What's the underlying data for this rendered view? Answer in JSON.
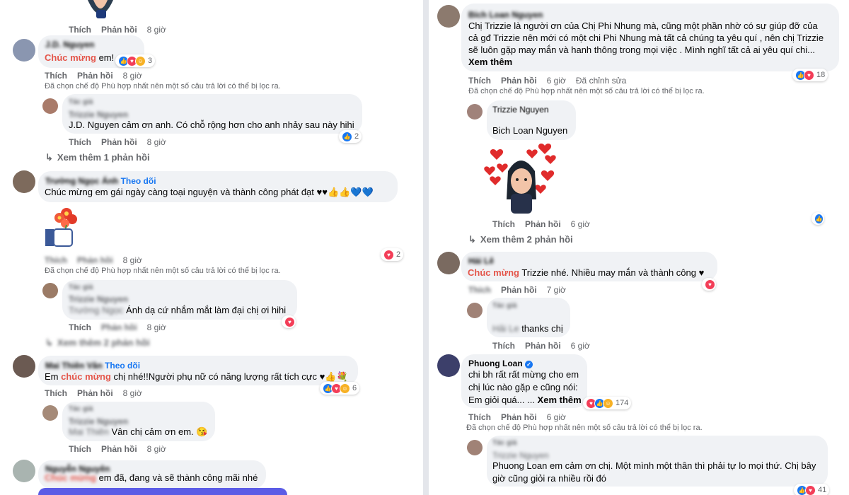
{
  "labels": {
    "like": "Thích",
    "reply": "Phản hồi",
    "edited": "Đã chỉnh sửa",
    "filter_notice": "Đã chọn chế độ Phù hợp nhất nên một số câu trả lời có thể bị lọc ra.",
    "follow": "Theo dõi",
    "see_more": "Xem thêm",
    "arrow": "↳"
  },
  "left": {
    "top": {
      "time": "8 giờ"
    },
    "c1": {
      "name": "J.D. Nguyen",
      "text_red": "Chúc mừng",
      "text": " em!",
      "reactions": "3",
      "time": "8 giờ"
    },
    "c1r1": {
      "name_line1": "Tác giả",
      "name_line2": "Trizzie Nguyen",
      "text": "J.D. Nguyen cảm ơn anh. Có chỗ rộng hơn cho anh nhảy sau này hihi",
      "reactions": "2",
      "time": "8 giờ"
    },
    "c1_more": "Xem thêm 1 phản hồi",
    "c2": {
      "name": "Trường Ngọc Ánh",
      "text": "Chúc mừng em gái ngày càng toại nguyện và thành công phát đạt ♥♥👍👍💙💙",
      "reactions": "2",
      "like": "Thích",
      "time": "8 giờ"
    },
    "c2r1": {
      "name_line1": "Tác giả",
      "name_line2": "Trizzie Nguyen",
      "text_blur": "Trường Ngọc",
      "text": " Ánh dạ cứ nhắm mắt làm đại chị ơi hihi",
      "time": "8 giờ"
    },
    "c2_more": "Xem thêm 2 phản hồi",
    "c3": {
      "name": "Mai Thiên Vân",
      "text_pre": "Em ",
      "text_red": "chúc mừng",
      "text": " chị nhé!!Người phụ nữ có năng lượng rất tích cực ♥👍💐",
      "reactions": "6",
      "time": "8 giờ"
    },
    "c3r1": {
      "name_line1": "Tác giả",
      "name_line2": "Trizzie Nguyen",
      "text_blur": "Mai Thiên",
      "text": " Vân chị cảm ơn em. 😘",
      "time": "8 giờ"
    },
    "c4": {
      "name": "Nguyễn Nguyên",
      "text_blur": "Chúc mừng",
      "text": " em đã, đang và sẽ thành công mãi nhé"
    }
  },
  "right": {
    "c1": {
      "name": "Bích Loan Nguyen",
      "text": "Chị Trizzie là người ơn của Chị Phi Nhung mà, cũng một phần nhờ có sự giúp đỡ của cả gđ Trizzie nên mới có một chi Phi Nhung mà tất cả chúng ta yêu quí , nên chị Trizzie sẽ luôn gặp may mắn và hanh thông trong mọi việc . Mình nghĩ tất cả ai yêu quí chi...",
      "see_more": " Xem thêm",
      "reactions": "18",
      "time": "6 giờ"
    },
    "c1r1": {
      "name": "Trizzie Nguyen",
      "text": "Bich Loan Nguyen",
      "time": "6 giờ"
    },
    "c1_more": "Xem thêm 2 phản hồi",
    "c2": {
      "name": "Hải Lê",
      "text_red": "Chúc mừng",
      "text": " Trizzie nhé. Nhiều may mắn và thành công ♥",
      "time": "7 giờ"
    },
    "c2r1": {
      "name_line1": "Tác giả",
      "text_blur": "Hải Le",
      "text": " thanks chị",
      "time": "6 giờ"
    },
    "c3": {
      "name": "Phuong Loan",
      "line1": "chi bh rất rất mừng cho em",
      "line2": "chị lúc nào gặp e cũng nói:",
      "line3": "Em giỏi quá... ...",
      "see_more": " Xem thêm",
      "reactions": "174",
      "time": "6 giờ"
    },
    "c3r1": {
      "name_line1": "Tác giả",
      "name_line2": "Trizzie Nguyen",
      "text_name": "Phuong Loan",
      "text": " em cảm ơn chị. Một mình một thân thì phải tự lo mọi thứ. Chị bây giờ cũng giỏi ra nhiều rồi đó",
      "reactions": "41"
    }
  }
}
